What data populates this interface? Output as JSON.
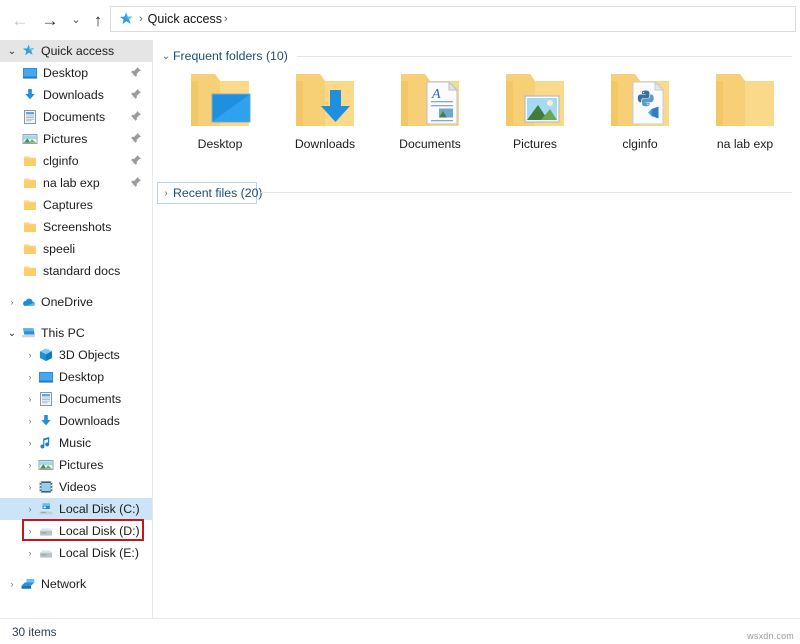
{
  "window": {
    "status_text": "30 items",
    "watermark": "wsxdn.com"
  },
  "navbar": {
    "back_label": "←",
    "back_icon": "back-arrow-icon",
    "forward_label": "→",
    "forward_icon": "forward-arrow-icon",
    "recent_label": "⌄",
    "recent_icon": "recent-locations-chevron-icon",
    "up_label": "↑",
    "up_icon": "up-arrow-icon",
    "address": {
      "icon": "quick-access-star-icon",
      "separator": "›",
      "crumb": "Quick access",
      "trailing_separator": "›"
    }
  },
  "sidebar": {
    "items": [
      {
        "label": "Quick access",
        "chev": "⌄",
        "expanded": true,
        "indent": 0,
        "icon": "star-icon",
        "pinned": false,
        "selected_grey": true
      },
      {
        "label": "Desktop",
        "chev": "",
        "expanded": false,
        "indent": 1,
        "icon": "desktop-icon",
        "pinned": true,
        "selected_grey": false
      },
      {
        "label": "Downloads",
        "chev": "",
        "expanded": false,
        "indent": 1,
        "icon": "downloads-icon",
        "pinned": true,
        "selected_grey": false
      },
      {
        "label": "Documents",
        "chev": "",
        "expanded": false,
        "indent": 1,
        "icon": "documents-icon",
        "pinned": true,
        "selected_grey": false
      },
      {
        "label": "Pictures",
        "chev": "",
        "expanded": false,
        "indent": 1,
        "icon": "pictures-icon",
        "pinned": true,
        "selected_grey": false
      },
      {
        "label": "clginfo",
        "chev": "",
        "expanded": false,
        "indent": 1,
        "icon": "folder-icon",
        "pinned": true,
        "selected_grey": false
      },
      {
        "label": "na lab exp",
        "chev": "",
        "expanded": false,
        "indent": 1,
        "icon": "folder-icon",
        "pinned": true,
        "selected_grey": false
      },
      {
        "label": "Captures",
        "chev": "",
        "expanded": false,
        "indent": 1,
        "icon": "folder-icon",
        "pinned": false,
        "selected_grey": false
      },
      {
        "label": "Screenshots",
        "chev": "",
        "expanded": false,
        "indent": 1,
        "icon": "folder-icon",
        "pinned": false,
        "selected_grey": false
      },
      {
        "label": "speeli",
        "chev": "",
        "expanded": false,
        "indent": 1,
        "icon": "folder-icon",
        "pinned": false,
        "selected_grey": false
      },
      {
        "label": "standard docs",
        "chev": "",
        "expanded": false,
        "indent": 1,
        "icon": "folder-icon",
        "pinned": false,
        "selected_grey": false
      }
    ],
    "onedrive": {
      "label": "OneDrive",
      "chev": "›",
      "icon": "onedrive-cloud-icon"
    },
    "thispc": {
      "label": "This PC",
      "chev": "⌄",
      "icon": "this-pc-icon"
    },
    "thispc_children": [
      {
        "label": "3D Objects",
        "chev": "›",
        "icon": "3d-objects-icon"
      },
      {
        "label": "Desktop",
        "chev": "›",
        "icon": "desktop-icon"
      },
      {
        "label": "Documents",
        "chev": "›",
        "icon": "documents-icon"
      },
      {
        "label": "Downloads",
        "chev": "›",
        "icon": "downloads-icon"
      },
      {
        "label": "Music",
        "chev": "›",
        "icon": "music-note-icon"
      },
      {
        "label": "Pictures",
        "chev": "›",
        "icon": "pictures-icon"
      },
      {
        "label": "Videos",
        "chev": "›",
        "icon": "videos-icon"
      },
      {
        "label": "Local Disk (C:)",
        "chev": "›",
        "icon": "system-drive-icon",
        "selected_blue": true,
        "highlight_box": true
      },
      {
        "label": "Local Disk (D:)",
        "chev": "›",
        "icon": "drive-icon"
      },
      {
        "label": "Local Disk (E:)",
        "chev": "›",
        "icon": "drive-icon"
      }
    ],
    "network": {
      "label": "Network",
      "chev": "›",
      "icon": "network-icon"
    }
  },
  "content": {
    "groups": [
      {
        "title": "Frequent folders (10)",
        "chev": "⌄",
        "expanded": true
      },
      {
        "title": "Recent files (20)",
        "chev": "›",
        "expanded": false
      }
    ],
    "frequent_folders": [
      {
        "label": "Desktop",
        "icon": "folder-desktop-icon"
      },
      {
        "label": "Downloads",
        "icon": "folder-downloads-icon"
      },
      {
        "label": "Documents",
        "icon": "folder-documents-icon"
      },
      {
        "label": "Pictures",
        "icon": "folder-pictures-icon"
      },
      {
        "label": "clginfo",
        "icon": "folder-python-icon"
      },
      {
        "label": "na lab exp",
        "icon": "folder-plain-icon"
      }
    ]
  },
  "colors": {
    "accent_blue": "#0078d7",
    "folder_yellow": "#fcd884",
    "highlight_red": "#c0181c",
    "selection_blue": "#cce4f7",
    "group_header_blue": "#1f4c72"
  }
}
